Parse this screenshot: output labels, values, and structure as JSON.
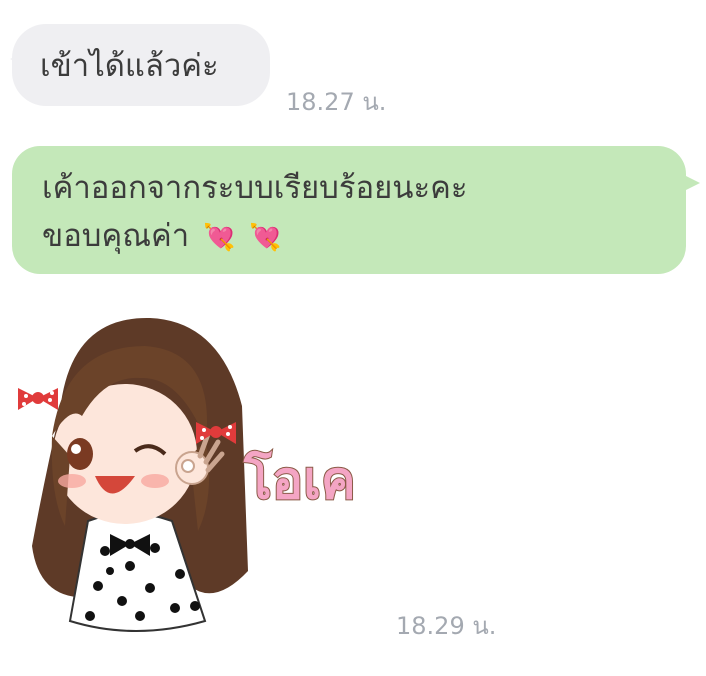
{
  "messages": [
    {
      "text": "เข้าได้แล้วค่ะ",
      "time": "18.27 น."
    },
    {
      "lines": [
        "เค้าออกจากระบบเรียบร้อยนะคะ",
        "ขอบคุณค่า"
      ],
      "emojis": [
        "💘",
        "💘"
      ]
    },
    {
      "sticker": {
        "icon": "girl-ok-sticker-icon",
        "caption": "โอเค"
      },
      "time": "18.29 น."
    }
  ],
  "colors": {
    "incoming_bubble": "#efeff2",
    "outgoing_bubble": "#c4e8b9",
    "timestamp": "#a4a9b1",
    "text": "#3c3c3c"
  }
}
